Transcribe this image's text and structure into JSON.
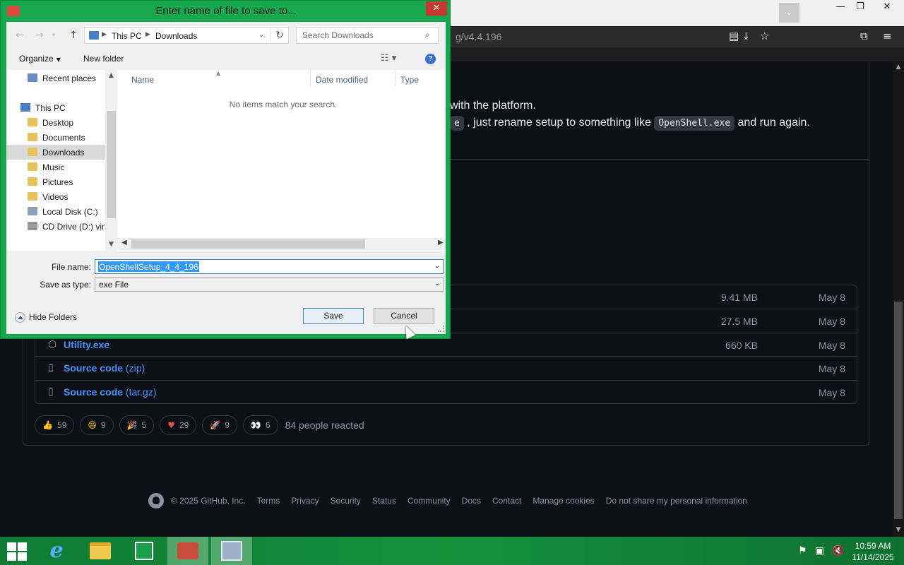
{
  "browser": {
    "url_partial": "g/v4.4.196",
    "minimize_icon": "minimize-icon",
    "restore_icon": "restore-icon",
    "close_icon": "close-icon"
  },
  "page": {
    "text_line1": "with the platform.",
    "text_line2_pre": "e",
    "text_line2_mid": ", just rename setup to something like",
    "text_line2_code": "OpenShell.exe",
    "text_line2_post": "and run again."
  },
  "assets": [
    {
      "name": "",
      "suffix": "",
      "size": "9.41 MB",
      "date": "May 8",
      "icon": "package-icon"
    },
    {
      "name": "",
      "suffix": "",
      "size": "27.5 MB",
      "date": "May 8",
      "icon": "package-icon"
    },
    {
      "name": "Utility.exe",
      "suffix": "",
      "size": "660 KB",
      "date": "May 8",
      "icon": "package-icon"
    },
    {
      "name": "Source code",
      "suffix": "(zip)",
      "size": "",
      "date": "May 8",
      "icon": "file-zip-icon"
    },
    {
      "name": "Source code",
      "suffix": "(tar.gz)",
      "size": "",
      "date": "May 8",
      "icon": "file-zip-icon"
    }
  ],
  "reactions": {
    "items": [
      {
        "icon": "thumbs-up-icon",
        "glyph": "👍",
        "count": "59"
      },
      {
        "icon": "smile-icon",
        "glyph": "😄",
        "count": "9"
      },
      {
        "icon": "tada-icon",
        "glyph": "🎉",
        "count": "5"
      },
      {
        "icon": "heart-icon",
        "glyph": "♥",
        "count": "29"
      },
      {
        "icon": "rocket-icon",
        "glyph": "🚀",
        "count": "9"
      },
      {
        "icon": "eyes-icon",
        "glyph": "👀",
        "count": "6"
      }
    ],
    "summary": "84 people reacted"
  },
  "footer": {
    "copyright": "© 2025 GitHub, Inc.",
    "links": [
      "Terms",
      "Privacy",
      "Security",
      "Status",
      "Community",
      "Docs",
      "Contact",
      "Manage cookies",
      "Do not share my personal information"
    ]
  },
  "dialog": {
    "title": "Enter name of file to save to...",
    "breadcrumb": [
      "This PC",
      "Downloads"
    ],
    "search_placeholder": "Search Downloads",
    "organize": "Organize",
    "new_folder": "New folder",
    "nav_items": [
      {
        "label": "Recent places",
        "icon": "recent-places-icon",
        "color": "#6b8ac4",
        "indent": 1
      },
      {
        "label": "This PC",
        "icon": "computer-icon",
        "color": "#4a7fc6",
        "indent": 0
      },
      {
        "label": "Desktop",
        "icon": "folder-icon",
        "color": "#e8c35a",
        "indent": 1
      },
      {
        "label": "Documents",
        "icon": "folder-icon",
        "color": "#e8c35a",
        "indent": 1
      },
      {
        "label": "Downloads",
        "icon": "folder-icon",
        "color": "#e8c35a",
        "indent": 1,
        "selected": true
      },
      {
        "label": "Music",
        "icon": "folder-icon",
        "color": "#e8c35a",
        "indent": 1
      },
      {
        "label": "Pictures",
        "icon": "folder-icon",
        "color": "#e8c35a",
        "indent": 1
      },
      {
        "label": "Videos",
        "icon": "folder-icon",
        "color": "#e8c35a",
        "indent": 1
      },
      {
        "label": "Local Disk (C:)",
        "icon": "disk-icon",
        "color": "#8aa2b8",
        "indent": 1
      },
      {
        "label": "CD Drive (D:) virt",
        "icon": "cd-drive-icon",
        "color": "#9a9a9a",
        "indent": 1
      }
    ],
    "columns": [
      "Name",
      "Date modified",
      "Type"
    ],
    "empty_message": "No items match your search.",
    "file_name_label": "File name:",
    "file_name_value": "OpenShellSetup_4_4_196",
    "save_type_label": "Save as type:",
    "save_type_value": "exe File",
    "hide_folders": "Hide Folders",
    "save": "Save",
    "cancel": "Cancel"
  },
  "taskbar": {
    "time": "10:59 AM",
    "date": "11/14/2025",
    "apps": [
      "internet-explorer-icon",
      "file-explorer-icon",
      "store-icon",
      "open-shell-icon",
      "installer-icon"
    ]
  }
}
